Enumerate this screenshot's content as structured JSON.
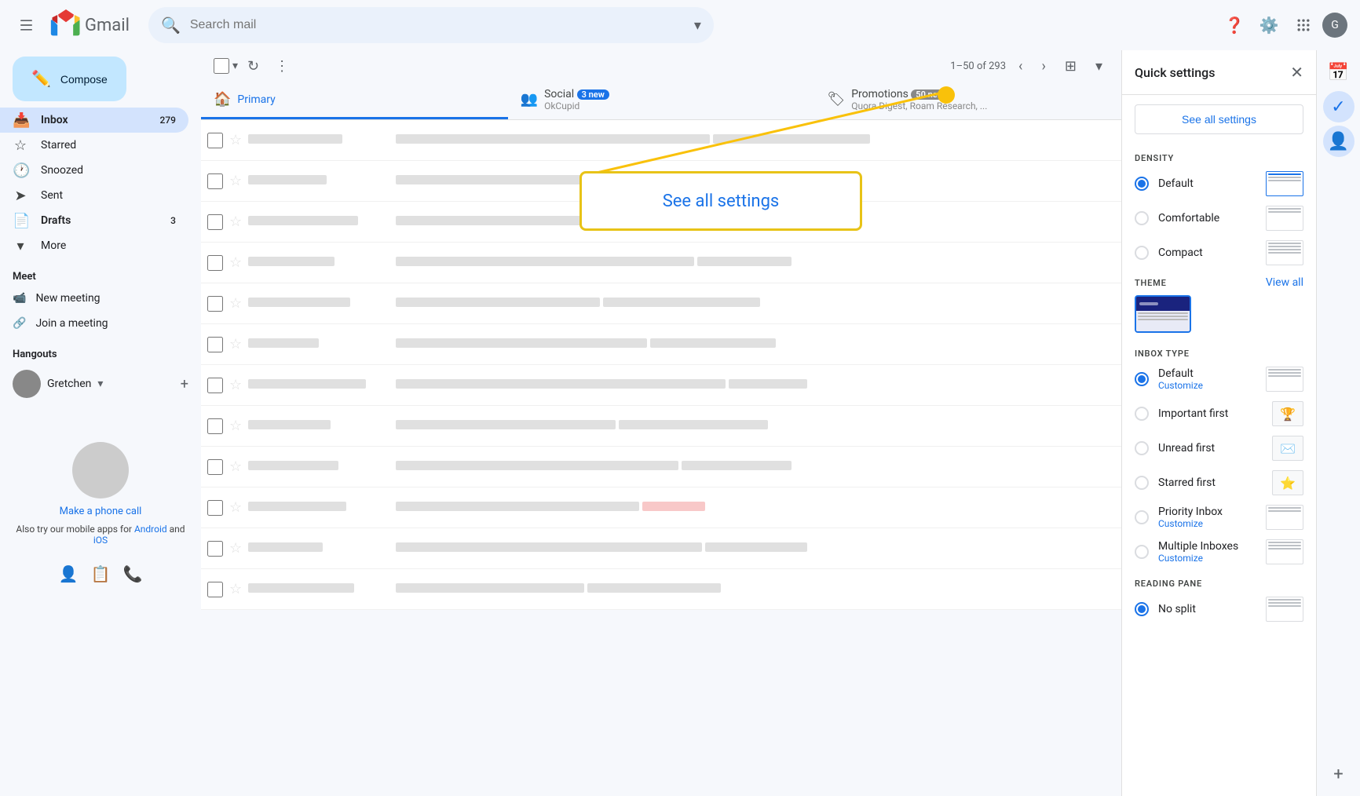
{
  "app": {
    "title": "Gmail",
    "logo_text": "Gmail"
  },
  "topbar": {
    "search_placeholder": "Search mail",
    "hamburger_icon": "☰",
    "help_icon": "?",
    "settings_icon": "⚙",
    "apps_icon": "⋮⋮⋮",
    "avatar_text": "G"
  },
  "sidebar": {
    "compose_label": "Compose",
    "nav_items": [
      {
        "label": "Inbox",
        "icon": "📥",
        "badge": "279",
        "active": true
      },
      {
        "label": "Starred",
        "icon": "☆",
        "badge": "",
        "active": false
      },
      {
        "label": "Snoozed",
        "icon": "🕐",
        "badge": "",
        "active": false
      },
      {
        "label": "Sent",
        "icon": "➤",
        "badge": "",
        "active": false
      },
      {
        "label": "Drafts",
        "icon": "📄",
        "badge": "3",
        "active": false
      },
      {
        "label": "More",
        "icon": "▾",
        "badge": "",
        "active": false
      }
    ],
    "meet_section": "Meet",
    "meet_items": [
      {
        "label": "New meeting",
        "icon": "📹"
      },
      {
        "label": "Join a meeting",
        "icon": "🔗"
      }
    ],
    "hangouts_section": "Hangouts",
    "hangouts_user": "Gretchen",
    "phone_call_label": "Make a phone call",
    "phone_text": "Also try our mobile apps for",
    "phone_android": "Android",
    "phone_ios": "iOS"
  },
  "toolbar": {
    "pagination": "1–50 of 293"
  },
  "tabs": [
    {
      "label": "Primary",
      "icon": "🏠",
      "badge": "",
      "active": true
    },
    {
      "label": "Social",
      "icon": "👥",
      "badge": "3 new",
      "active": false,
      "subtitle": "OkCupid"
    },
    {
      "label": "Promotions",
      "icon": "🏷",
      "badge": "50 new",
      "active": false,
      "subtitle": "Quora Digest, Roam Research, ..."
    }
  ],
  "quick_settings": {
    "title": "Quick settings",
    "see_all_label": "See all settings",
    "density_label": "DENSITY",
    "density_options": [
      {
        "label": "Default",
        "selected": true
      },
      {
        "label": "Comfortable",
        "selected": false
      },
      {
        "label": "Compact",
        "selected": false
      }
    ],
    "theme_label": "THEME",
    "view_all_label": "View all",
    "inbox_type_label": "INBOX TYPE",
    "inbox_options": [
      {
        "label": "Default",
        "selected": true,
        "sublabel": "Customize"
      },
      {
        "label": "Important first",
        "selected": false,
        "sublabel": ""
      },
      {
        "label": "Unread first",
        "selected": false,
        "sublabel": ""
      },
      {
        "label": "Starred first",
        "selected": false,
        "sublabel": ""
      },
      {
        "label": "Priority Inbox",
        "selected": false,
        "sublabel": "Customize"
      },
      {
        "label": "Multiple Inboxes",
        "selected": false,
        "sublabel": "Customize"
      }
    ],
    "reading_pane_label": "READING PANE",
    "reading_pane_options": [
      {
        "label": "No split",
        "selected": true
      }
    ]
  },
  "callout": {
    "text": "See all settings",
    "dot_color": "#f9c10a"
  }
}
